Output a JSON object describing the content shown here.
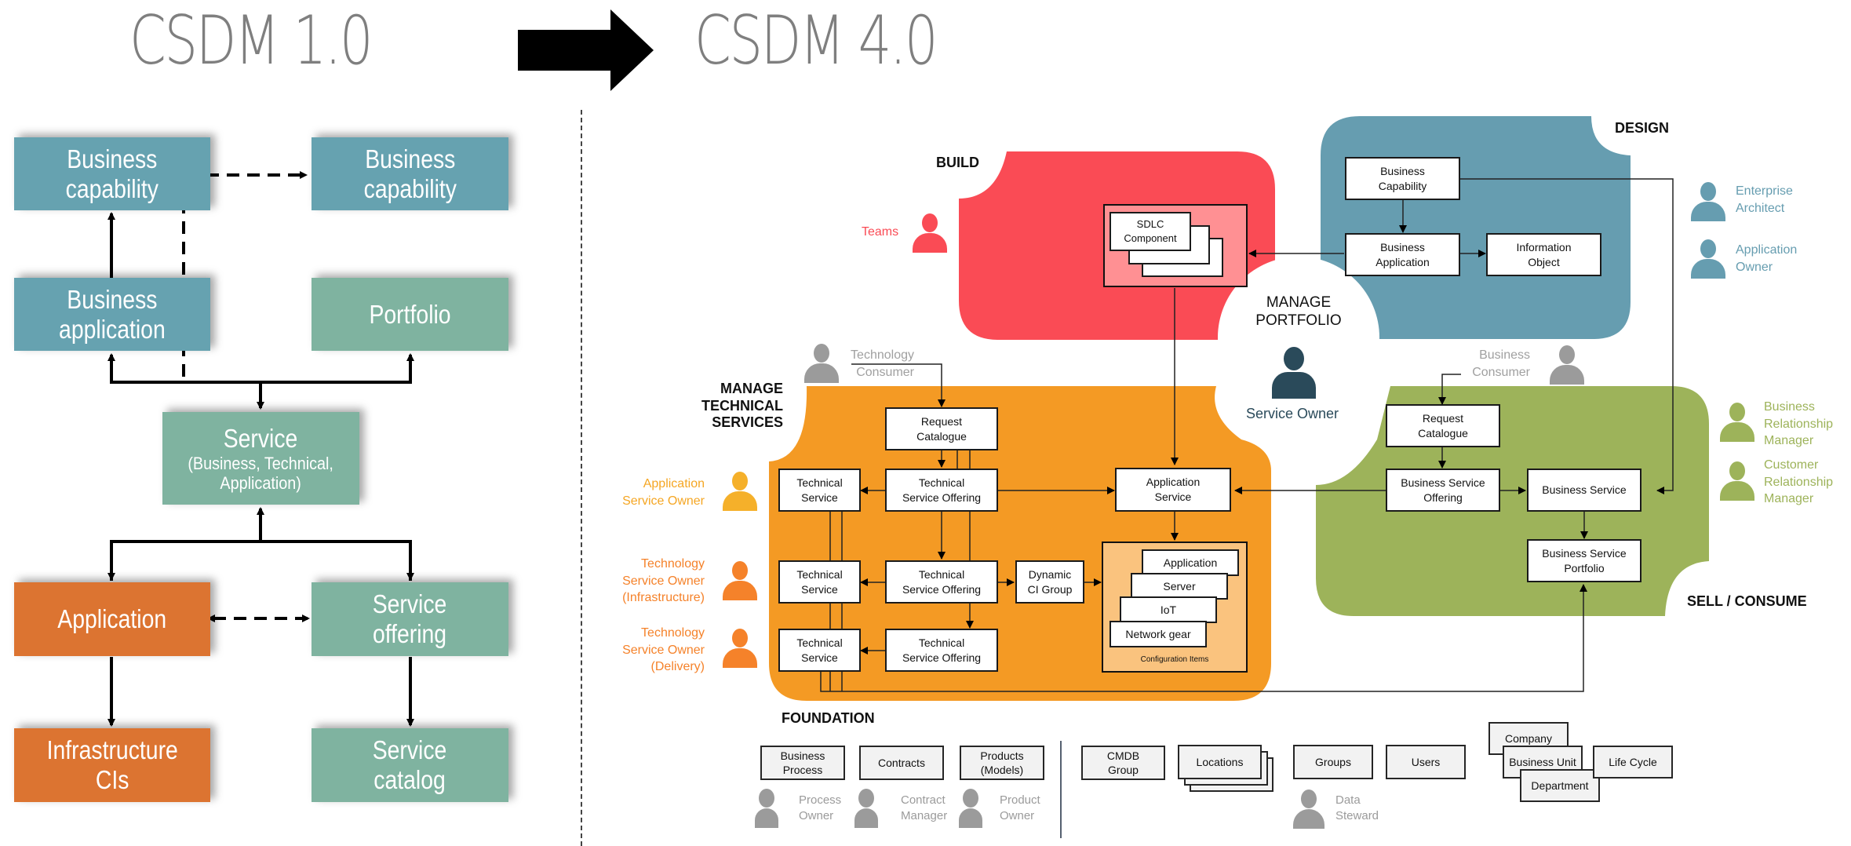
{
  "header": {
    "left_title": "CSDM 1.0",
    "right_title": "CSDM 4.0",
    "arrow_icon": "right-arrow"
  },
  "csdm1": {
    "boxes": {
      "business_capability_left": "Business\ncapability",
      "business_capability_right": "Business\ncapability",
      "business_application": "Business\napplication",
      "portfolio": "Portfolio",
      "service_title": "Service",
      "service_subtitle": "(Business, Technical,\nApplication)",
      "application": "Application",
      "service_offering": "Service\noffering",
      "infrastructure_cis": "Infrastructure\nCIs",
      "service_catalog": "Service\ncatalog"
    },
    "colors": {
      "teal": "#66a2b0",
      "sage": "#7fb3a0",
      "orange": "#dc7431"
    }
  },
  "csdm4": {
    "domains": {
      "build": "BUILD",
      "design": "DESIGN",
      "manage_technical_services": "MANAGE\nTECHNICAL SERVICES",
      "sell_consume": "SELL / CONSUME",
      "manage_portfolio": "MANAGE\nPORTFOLIO",
      "foundation": "FOUNDATION"
    },
    "colors": {
      "build": "#fa4b55",
      "design": "#669db0",
      "technical": "#f49a24",
      "sell": "#9db35a",
      "portfolio_person": "#2a4a5a"
    },
    "build": {
      "sdlc_component": "SDLC\nComponent"
    },
    "design": {
      "business_capability": "Business\nCapability",
      "business_application": "Business\nApplication",
      "information_object": "Information\nObject"
    },
    "technical": {
      "request_catalogue": "Request\nCatalogue",
      "technical_service": "Technical\nService",
      "technical_service_offering": "Technical\nService Offering",
      "dynamic_ci_group": "Dynamic\nCI Group",
      "application_service": "Application\nService",
      "config_items": [
        "Application",
        "Server",
        "IoT",
        "Network gear"
      ],
      "config_items_label": "Configuration Items"
    },
    "sell": {
      "request_catalogue": "Request\nCatalogue",
      "business_service_offering": "Business Service\nOffering",
      "business_service": "Business Service",
      "business_service_portfolio": "Business Service\nPortfolio"
    },
    "roles": {
      "teams": "Teams",
      "enterprise_architect": "Enterprise\nArchitect",
      "application_owner": "Application\nOwner",
      "technology_consumer": "Technology\nConsumer",
      "business_consumer": "Business\nConsumer",
      "service_owner": "Service Owner",
      "application_service_owner": "Application\nService Owner",
      "technology_service_owner_infra": "Technology\nService Owner\n(Infrastructure)",
      "technology_service_owner_delivery": "Technology\nService Owner\n(Delivery)",
      "business_relationship_manager": "Business\nRelationship\nManager",
      "customer_relationship_manager": "Customer\nRelationship\nManager"
    },
    "foundation": {
      "left": [
        "Business\nProcess",
        "Contracts",
        "Products\n(Models)"
      ],
      "left_roles": [
        "Process\nOwner",
        "Contract\nManager",
        "Product\nOwner"
      ],
      "right": [
        "CMDB\nGroup",
        "Locations",
        "Groups",
        "Users",
        "Company",
        "Business Unit",
        "Department",
        "Life Cycle"
      ],
      "data_steward": "Data\nSteward"
    }
  }
}
